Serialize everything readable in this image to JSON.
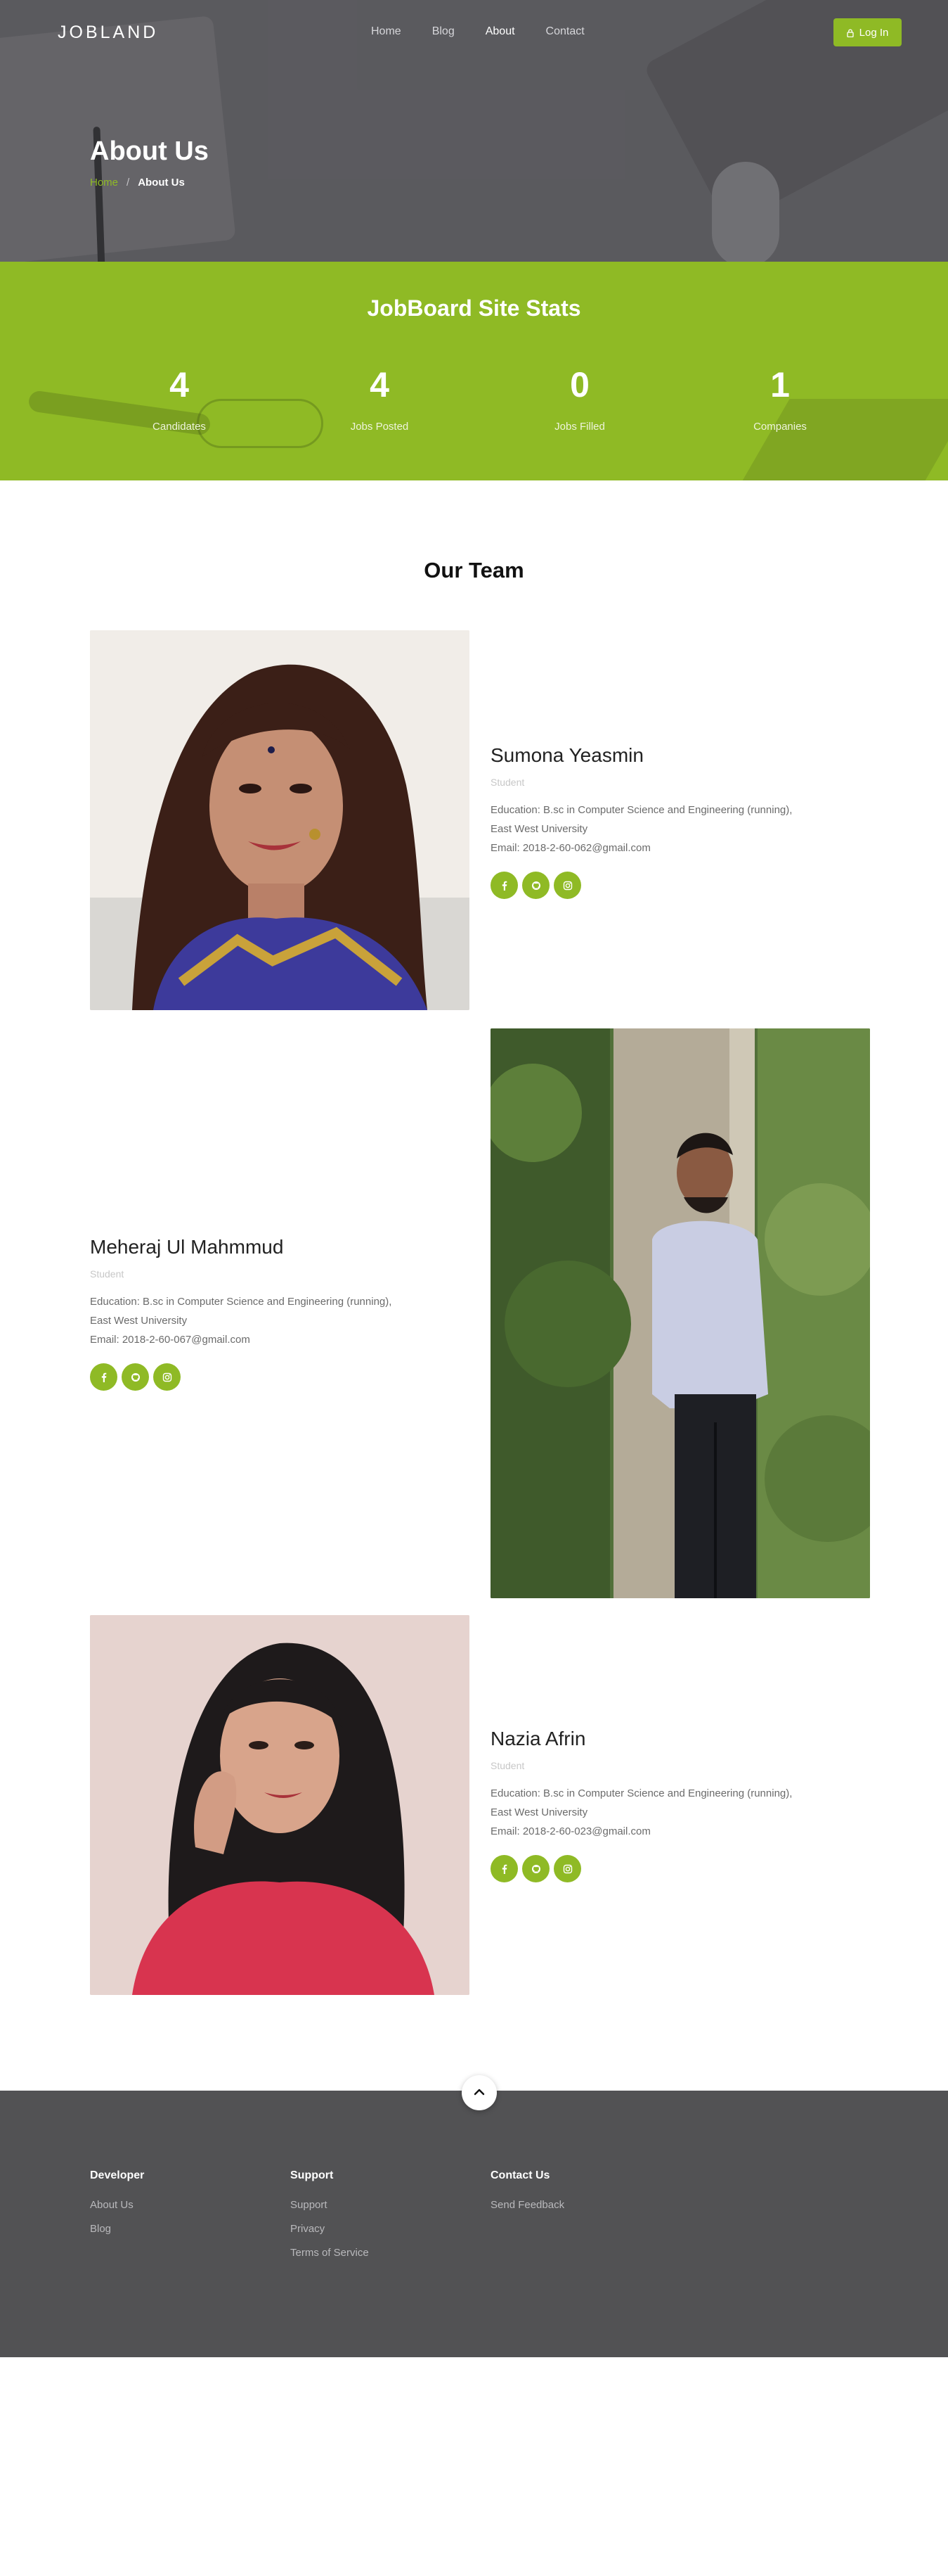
{
  "header": {
    "logo": "JOBLAND",
    "nav": [
      "Home",
      "Blog",
      "About",
      "Contact"
    ],
    "active_nav": "About",
    "login_label": "Log In"
  },
  "hero": {
    "title": "About Us",
    "breadcrumb": {
      "home": "Home",
      "separator": "/",
      "current": "About Us"
    }
  },
  "stats": {
    "title": "JobBoard Site Stats",
    "items": [
      {
        "value": "4",
        "label": "Candidates"
      },
      {
        "value": "4",
        "label": "Jobs Posted"
      },
      {
        "value": "0",
        "label": "Jobs Filled"
      },
      {
        "value": "1",
        "label": "Companies"
      }
    ]
  },
  "team": {
    "title": "Our Team",
    "members": [
      {
        "name": "Sumona Yeasmin",
        "role": "Student",
        "education": "Education: B.sc in Computer Science and Engineering (running),",
        "university": "East West University",
        "email": "Email: 2018-2-60-062@gmail.com"
      },
      {
        "name": "Meheraj Ul Mahmmud",
        "role": "Student",
        "education": "Education: B.sc in Computer Science and Engineering (running),",
        "university": "East West University",
        "email": "Email: 2018-2-60-067@gmail.com"
      },
      {
        "name": "Nazia Afrin",
        "role": "Student",
        "education": "Education: B.sc in Computer Science and Engineering (running),",
        "university": "East West University",
        "email": "Email: 2018-2-60-023@gmail.com"
      }
    ],
    "social_icons": [
      "facebook-icon",
      "github-icon",
      "instagram-icon"
    ]
  },
  "footer": {
    "columns": [
      {
        "title": "Developer",
        "links": [
          "About Us",
          "Blog"
        ]
      },
      {
        "title": "Support",
        "links": [
          "Support",
          "Privacy",
          "Terms of Service"
        ]
      },
      {
        "title": "Contact Us",
        "links": [
          "Send Feedback"
        ]
      }
    ]
  },
  "colors": {
    "accent": "#8fba25",
    "footer_bg": "#525254",
    "hero_bg": "#6b6a6f"
  }
}
